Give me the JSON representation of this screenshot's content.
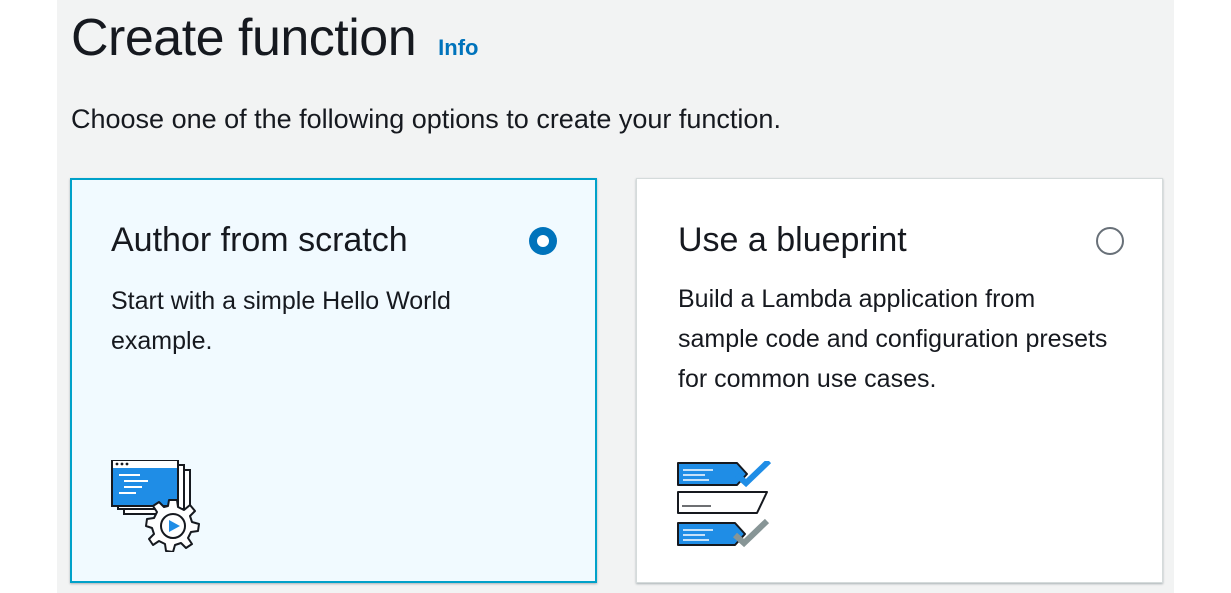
{
  "page": {
    "title": "Create function",
    "info_link": "Info",
    "description": "Choose one of the following options to create your function."
  },
  "options": [
    {
      "title": "Author from scratch",
      "description": "Start with a simple Hello World example.",
      "selected": true,
      "icon": "code-window-gear-icon"
    },
    {
      "title": "Use a blueprint",
      "description": "Build a Lambda application from sample code and configuration presets for common use cases.",
      "selected": false,
      "icon": "checklist-blueprint-icon"
    }
  ],
  "colors": {
    "accent": "#0073bb",
    "selected_border": "#00a1c9",
    "selected_bg": "#f1faff",
    "illustration_blue": "#1f8de6",
    "page_bg": "#f2f3f3"
  }
}
